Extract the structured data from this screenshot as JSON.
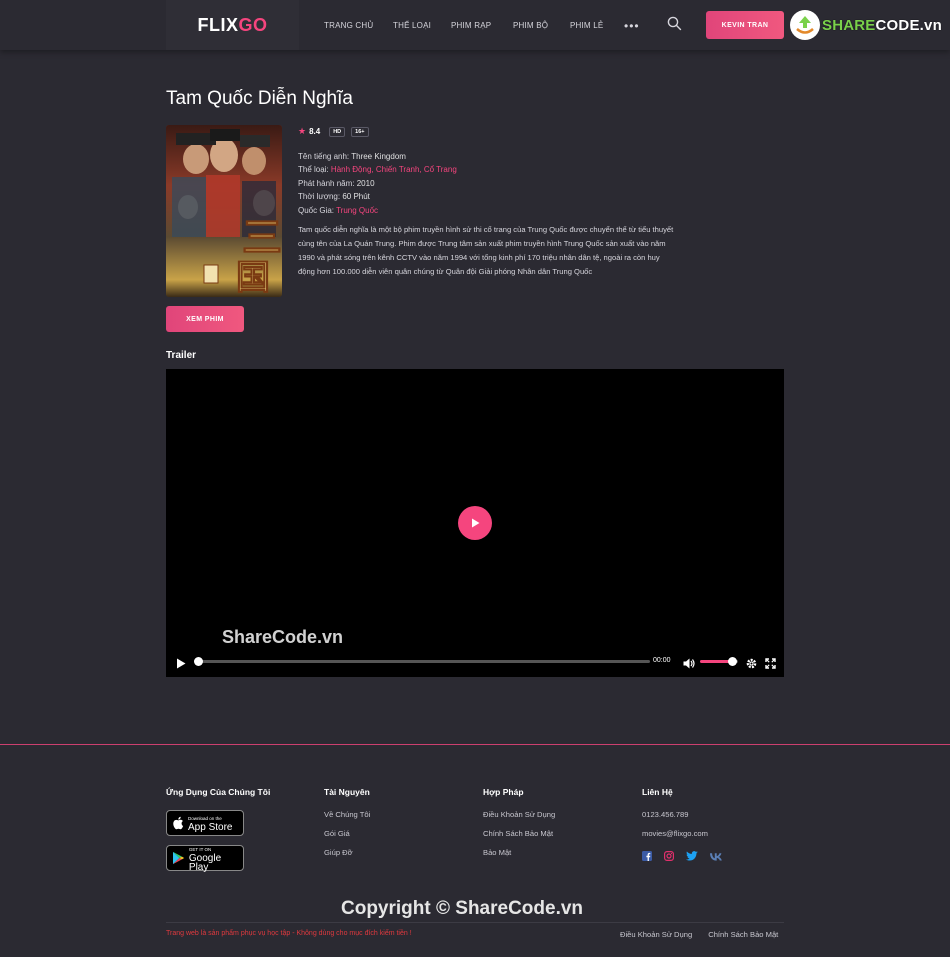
{
  "header": {
    "logo_part1": "FLIX",
    "logo_part2": "GO",
    "nav": [
      {
        "label": "TRANG CHỦ"
      },
      {
        "label": "THỂ LOẠI"
      },
      {
        "label": "PHIM RẠP"
      },
      {
        "label": "PHIM BỘ"
      },
      {
        "label": "PHIM LẺ"
      }
    ],
    "more": "•••",
    "user_label": "KEVIN TRAN",
    "partner_logo_part1": "SHARE",
    "partner_logo_part2": "CODE.vn"
  },
  "movie": {
    "title": "Tam Quốc Diễn Nghĩa",
    "rating": "8.4",
    "tags": [
      "HD",
      "16+"
    ],
    "english_name_label": "Tên tiếng anh:",
    "english_name": "Three Kingdom",
    "genre_label": "Thể loại:",
    "genres": "Hành Động, Chiến Tranh, Cổ Trang",
    "release_label": "Phát hành năm:",
    "release": "2010",
    "duration_label": "Thời lượng:",
    "duration": "60 Phút",
    "country_label": "Quốc Gia:",
    "country": "Trung Quốc",
    "description": "Tam quốc diễn nghĩa là một bộ phim truyền hình sử thi cổ trang của Trung Quốc được chuyển thể từ tiểu thuyết cùng tên của La Quán Trung. Phim được Trung tâm sản xuất phim truyền hình Trung Quốc sản xuất vào năm 1990 và phát sóng trên kênh CCTV vào năm 1994 với tổng kinh phí 170 triệu nhân dân tệ, ngoài ra còn huy động hơn 100.000 diễn viên quân chúng từ Quân đội Giải phóng Nhân dân Trung Quốc",
    "watch_label": "XEM PHIM"
  },
  "trailer": {
    "title": "Trailer",
    "watermark": "ShareCode.vn",
    "time": "00:00",
    "progress": 0,
    "volume": 0.85
  },
  "footer": {
    "apps_title": "Ứng Dụng Của Chúng Tôi",
    "appstore_small": "Download on the",
    "appstore_big": "App Store",
    "googleplay_small": "GET IT ON",
    "googleplay_big": "Google Play",
    "resources_title": "Tài Nguyên",
    "resources": [
      "Về Chúng Tôi",
      "Gói Giá",
      "Giúp Đỡ"
    ],
    "legal_title": "Hợp Pháp",
    "legal": [
      "Điều Khoản Sử Dụng",
      "Chính Sách Bảo Mật",
      "Bảo Mật"
    ],
    "contact_title": "Liên Hệ",
    "phone": "0123.456.789",
    "email": "movies@flixgo.com",
    "socials": [
      "facebook-icon",
      "instagram-icon",
      "twitter-icon",
      "vk-icon"
    ],
    "watermark": "Copyright © ShareCode.vn",
    "note": "Trang web là sản phẩm phục vụ học tập - Không dùng cho mục đích kiếm tiền !",
    "bottom_links": [
      "Điều Khoản Sử Dụng",
      "Chính Sách Bảo Mật"
    ]
  },
  "colors": {
    "accent": "#f5457e",
    "background": "#2b2a32",
    "note": "#e0393e"
  }
}
